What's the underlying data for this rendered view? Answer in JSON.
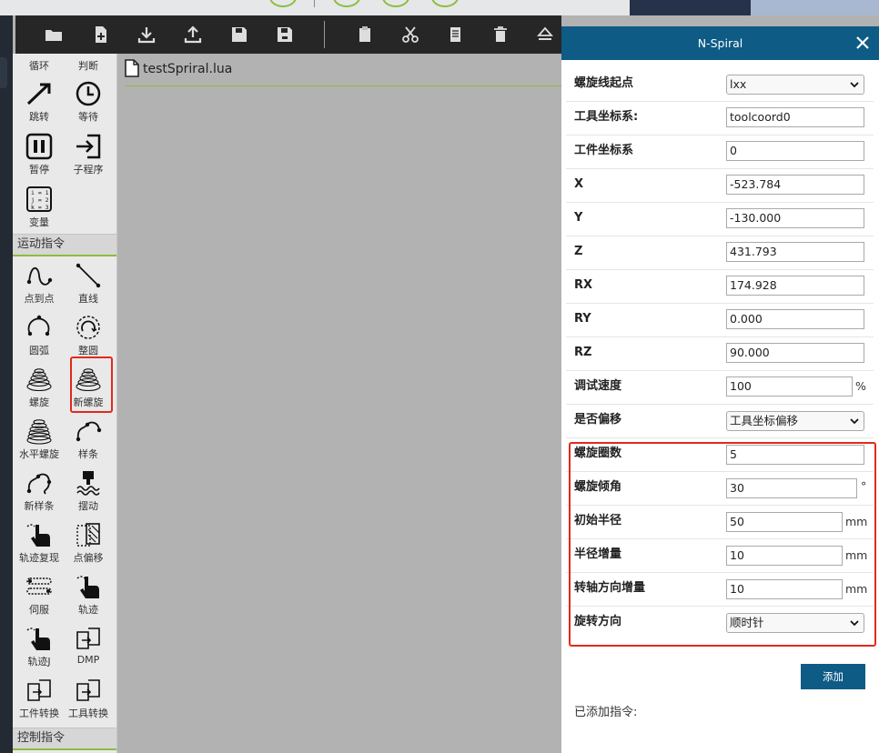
{
  "toolbar": {
    "icons": [
      "open-folder-icon",
      "new-file-icon",
      "download-icon",
      "upload-icon",
      "save-icon",
      "save-as-icon",
      "paste-icon",
      "cut-icon",
      "copy-icon",
      "delete-icon",
      "eject-icon"
    ]
  },
  "file_tab": {
    "name": "testSpriral.lua"
  },
  "palette": {
    "top_labels": [
      "循环",
      "判断"
    ],
    "tools_logic": [
      {
        "label": "跳转",
        "icon": "jump-icon"
      },
      {
        "label": "等待",
        "icon": "clock-icon"
      },
      {
        "label": "暂停",
        "icon": "pause-icon"
      },
      {
        "label": "子程序",
        "icon": "subprogram-icon"
      },
      {
        "label": "变量",
        "icon": "variable-icon"
      }
    ],
    "motion_section": "运动指令",
    "tools_motion": [
      {
        "label": "点到点",
        "icon": "ptp-icon"
      },
      {
        "label": "直线",
        "icon": "line-icon"
      },
      {
        "label": "圆弧",
        "icon": "arc-icon"
      },
      {
        "label": "整圆",
        "icon": "circle-icon"
      },
      {
        "label": "螺旋",
        "icon": "spiral-icon"
      },
      {
        "label": "新螺旋",
        "icon": "new-spiral-icon"
      },
      {
        "label": "水平螺旋",
        "icon": "horizontal-spiral-icon"
      },
      {
        "label": "样条",
        "icon": "spline-icon"
      },
      {
        "label": "新样条",
        "icon": "new-spline-icon"
      },
      {
        "label": "摆动",
        "icon": "weave-icon"
      },
      {
        "label": "轨迹复现",
        "icon": "trajectory-replay-icon"
      },
      {
        "label": "点偏移",
        "icon": "point-offset-icon"
      },
      {
        "label": "伺服",
        "icon": "servo-icon"
      },
      {
        "label": "轨迹",
        "icon": "trajectory-icon"
      },
      {
        "label": "轨迹J",
        "icon": "trajectory-j-icon"
      },
      {
        "label": "DMP",
        "icon": "dmp-icon"
      },
      {
        "label": "工件转换",
        "icon": "workpiece-convert-icon"
      },
      {
        "label": "工具转换",
        "icon": "tool-convert-icon"
      }
    ],
    "control_section": "控制指令"
  },
  "dialog": {
    "title": "N-Spiral",
    "fields": {
      "start_point": {
        "label": "螺旋线起点",
        "value": "lxx"
      },
      "tool_coord": {
        "label": "工具坐标系:",
        "value": "toolcoord0"
      },
      "work_coord": {
        "label": "工件坐标系",
        "value": "0"
      },
      "x": {
        "label": "X",
        "value": "-523.784"
      },
      "y": {
        "label": "Y",
        "value": "-130.000"
      },
      "z": {
        "label": "Z",
        "value": "431.793"
      },
      "rx": {
        "label": "RX",
        "value": "174.928"
      },
      "ry": {
        "label": "RY",
        "value": "0.000"
      },
      "rz": {
        "label": "RZ",
        "value": "90.000"
      },
      "speed": {
        "label": "调试速度",
        "value": "100",
        "unit": "%"
      },
      "offset": {
        "label": "是否偏移",
        "value": "工具坐标偏移"
      },
      "turns": {
        "label": "螺旋圈数",
        "value": "5"
      },
      "incline": {
        "label": "螺旋倾角",
        "value": "30",
        "unit": "°"
      },
      "init_radius": {
        "label": "初始半径",
        "value": "50",
        "unit": "mm"
      },
      "radius_inc": {
        "label": "半径增量",
        "value": "10",
        "unit": "mm"
      },
      "axis_inc": {
        "label": "转轴方向增量",
        "value": "10",
        "unit": "mm"
      },
      "direction": {
        "label": "旋转方向",
        "value": "顺时针"
      }
    },
    "add_button": "添加",
    "added_label": "已添加指令:"
  },
  "colors": {
    "accent": "#0e5b86",
    "highlight": "#e02a1d",
    "green": "#8bbd3c"
  }
}
